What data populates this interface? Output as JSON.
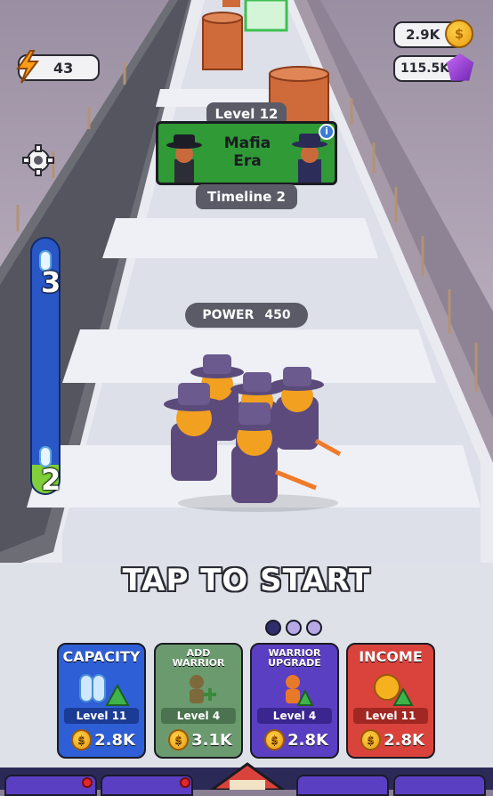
{
  "energy": {
    "value": "43"
  },
  "currency": {
    "coins": "2.9K",
    "gems": "115.5K"
  },
  "level": {
    "label": "Level 12"
  },
  "era": {
    "name_line1": "Mafia",
    "name_line2": "Era",
    "timeline": "Timeline 2"
  },
  "progress": {
    "top_value": "3",
    "bottom_value": "2"
  },
  "power": {
    "label": "POWER",
    "value": "450"
  },
  "start_prompt": "TAP TO START",
  "page_dots": {
    "count": 3,
    "active": 0
  },
  "upgrades": [
    {
      "title": "CAPACITY",
      "level": "Level 11",
      "cost": "2.8K",
      "color": "#2f5fd6",
      "icon": "capacity-icon"
    },
    {
      "title_line1": "ADD",
      "title_line2": "WARRIOR",
      "level": "Level 4",
      "cost": "3.1K",
      "color": "#6b9a6f",
      "icon": "add-warrior-icon"
    },
    {
      "title_line1": "WARRIOR",
      "title_line2": "UPGRADE",
      "level": "Level 4",
      "cost": "2.8K",
      "color": "#5a3fc2",
      "icon": "warrior-upgrade-icon"
    },
    {
      "title": "INCOME",
      "level": "Level 11",
      "cost": "2.8K",
      "color": "#d9433c",
      "icon": "income-icon"
    }
  ],
  "colors": {
    "accent": "#2f5fd6",
    "progress_fill": "#7fcf3a",
    "progress_bar": "#2a57c6"
  }
}
